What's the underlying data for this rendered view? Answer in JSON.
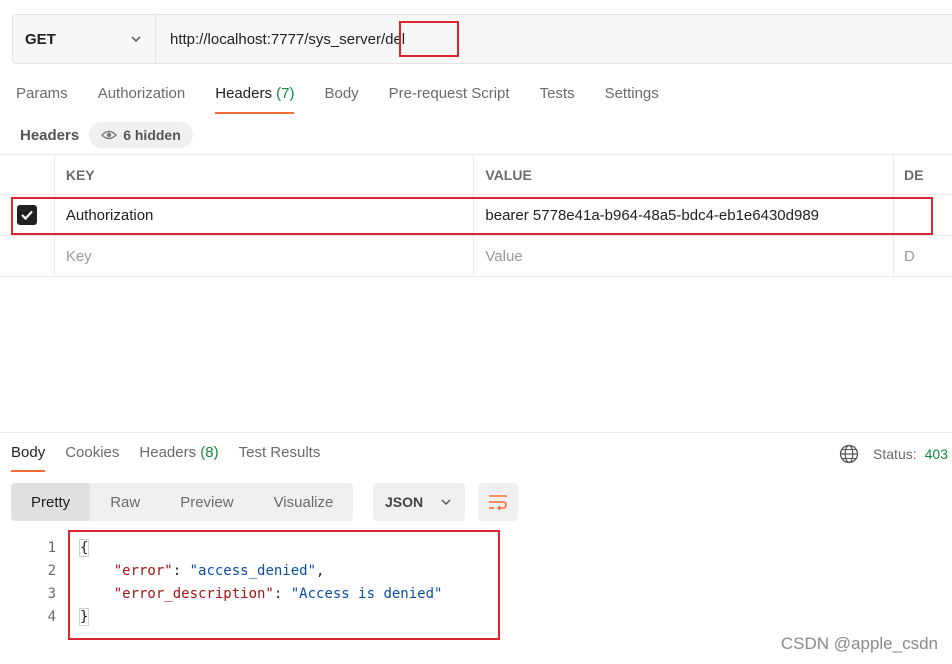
{
  "request": {
    "method": "GET",
    "url_prefix": "http://localhost:7777/sys_server",
    "url_suffix": "/del"
  },
  "request_tabs": [
    {
      "label": "Params"
    },
    {
      "label": "Authorization"
    },
    {
      "label": "Headers",
      "count": "(7)"
    },
    {
      "label": "Body"
    },
    {
      "label": "Pre-request Script"
    },
    {
      "label": "Tests"
    },
    {
      "label": "Settings"
    }
  ],
  "headers_section": {
    "title": "Headers",
    "hidden_pill": "6 hidden"
  },
  "table": {
    "columns": [
      "KEY",
      "VALUE",
      "DE"
    ],
    "row": {
      "key": "Authorization",
      "value": "bearer 5778e41a-b964-48a5-bdc4-eb1e6430d989",
      "checked": true
    },
    "placeholder": {
      "key": "Key",
      "value": "Value",
      "extra": "D"
    }
  },
  "response_tabs": [
    {
      "label": "Body"
    },
    {
      "label": "Cookies"
    },
    {
      "label": "Headers",
      "count": "(8)"
    },
    {
      "label": "Test Results"
    }
  ],
  "status": {
    "label": "Status:",
    "code": "403"
  },
  "view_modes": [
    "Pretty",
    "Raw",
    "Preview",
    "Visualize"
  ],
  "language": "JSON",
  "code_lines": [
    {
      "num": "1",
      "open": "{"
    },
    {
      "num": "2",
      "key": "\"error\"",
      "sep": ": ",
      "value": "\"access_denied\"",
      "end": ","
    },
    {
      "num": "3",
      "key": "\"error_description\"",
      "sep": ": ",
      "value": "\"Access is denied\"",
      "end": ""
    },
    {
      "num": "4",
      "close": "}"
    }
  ],
  "watermark": "CSDN @apple_csdn",
  "colors": {
    "accent": "#ff6c37",
    "highlight": "#d9262e",
    "success": "#0f8a3e"
  }
}
